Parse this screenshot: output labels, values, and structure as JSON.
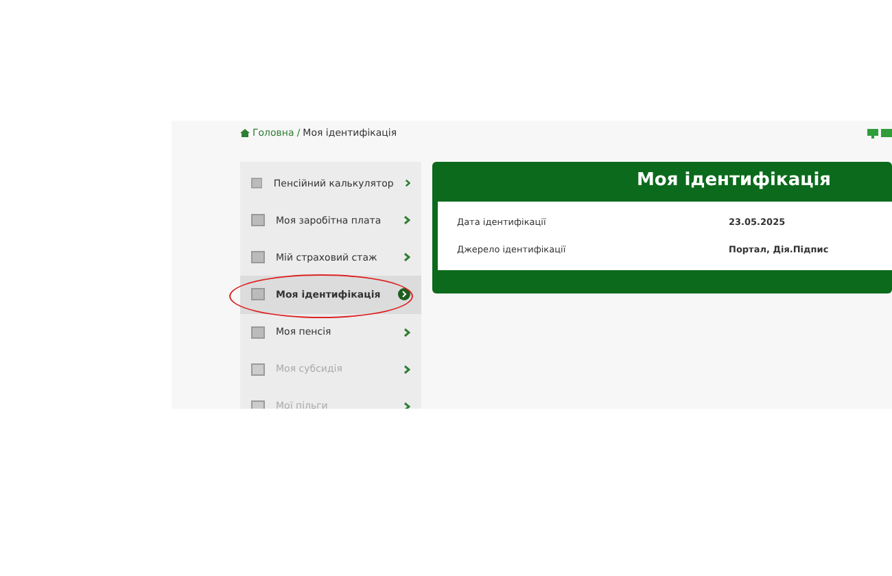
{
  "breadcrumb_separator": "/",
  "breadcrumb": [
    {
      "label": "Головна",
      "selected": false
    },
    {
      "label": "Моя ідентифікація",
      "selected": true
    }
  ],
  "sidebar": {
    "items": [
      {
        "label": "Пенсійний калькулятор",
        "selected": false,
        "disabled": false
      },
      {
        "label": "Моя заробітна плата",
        "selected": false,
        "disabled": false
      },
      {
        "label": "Мій страховий стаж",
        "selected": false,
        "disabled": false
      },
      {
        "label": "Моя ідентифікація",
        "selected": true,
        "disabled": false
      },
      {
        "label": "Моя пенсія",
        "selected": false,
        "disabled": false
      },
      {
        "label": "Моя субсидія",
        "selected": false,
        "disabled": true
      },
      {
        "label": "Мої пільги",
        "selected": false,
        "disabled": true
      }
    ]
  },
  "card": {
    "title": "Моя ідентифікація",
    "rows": [
      {
        "label": "Дата ідентифікації",
        "value": "23.05.2025"
      },
      {
        "label": "Джерело ідентифікації",
        "value": "Портал, Дія.Підпис"
      }
    ]
  }
}
